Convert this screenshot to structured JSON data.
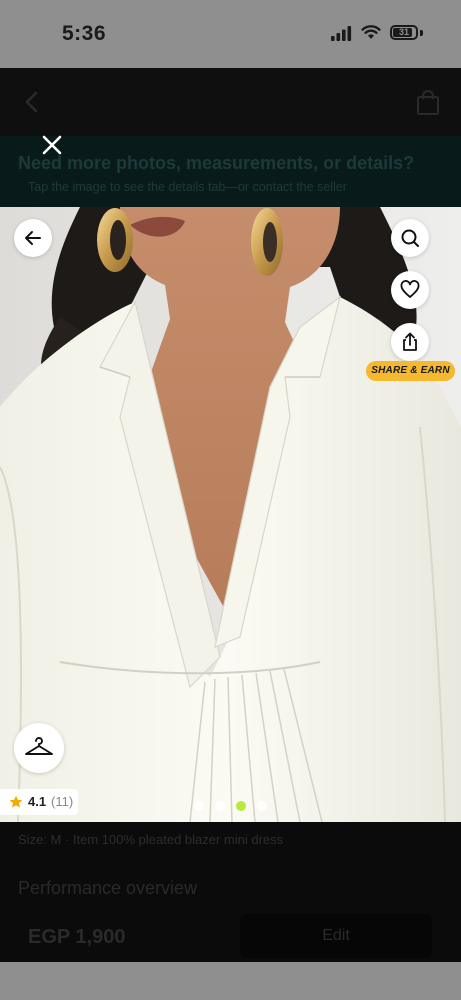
{
  "status_bar": {
    "time": "5:36",
    "battery": "31"
  },
  "notice": {
    "title": "Need more photos, measurements, or details?",
    "subtitle": "Tap the image to see the details tab—or contact the seller"
  },
  "viewer": {
    "share_label": "SHARE & EARN",
    "rating_value": "4.1",
    "rating_count": "(11)",
    "image_count": 4,
    "active_image": 3,
    "colors": {
      "dot_active": "#b8ea3c",
      "share_badge": "#f5b82e"
    }
  },
  "background": {
    "sku_line": "Size: M · Item 100% pleated blazer mini dress",
    "performance_heading": "Performance overview",
    "price": "EGP 1,900",
    "edit_label": "Edit"
  }
}
